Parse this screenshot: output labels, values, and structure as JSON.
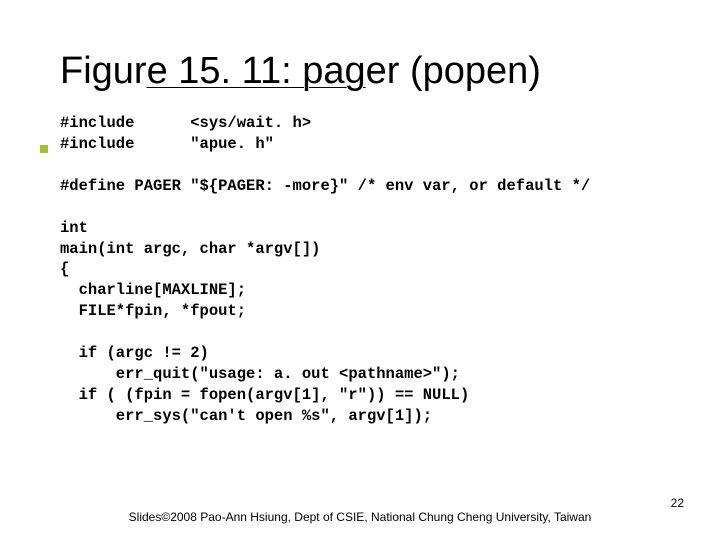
{
  "title_prefix": "Figur",
  "title_underlined": "e 15. 11: pa",
  "title_suffix_g": "g",
  "title_suffix_rest": "er (popen)",
  "code_lines": [
    "#include      <sys/wait. h>",
    "#include      \"apue. h\"",
    "",
    "#define PAGER \"${PAGER: -more}\" /* env var, or default */",
    "",
    "int",
    "main(int argc, char *argv[])",
    "{",
    "  charline[MAXLINE];",
    "  FILE*fpin, *fpout;",
    "",
    "  if (argc != 2)",
    "      err_quit(\"usage: a. out <pathname>\");",
    "  if ( (fpin = fopen(argv[1], \"r\")) == NULL)",
    "      err_sys(\"can't open %s\", argv[1]);"
  ],
  "footer_credit": "Slides©2008 Pao-Ann Hsiung, Dept of CSIE, National Chung Cheng University, Taiwan",
  "page_number": "22"
}
